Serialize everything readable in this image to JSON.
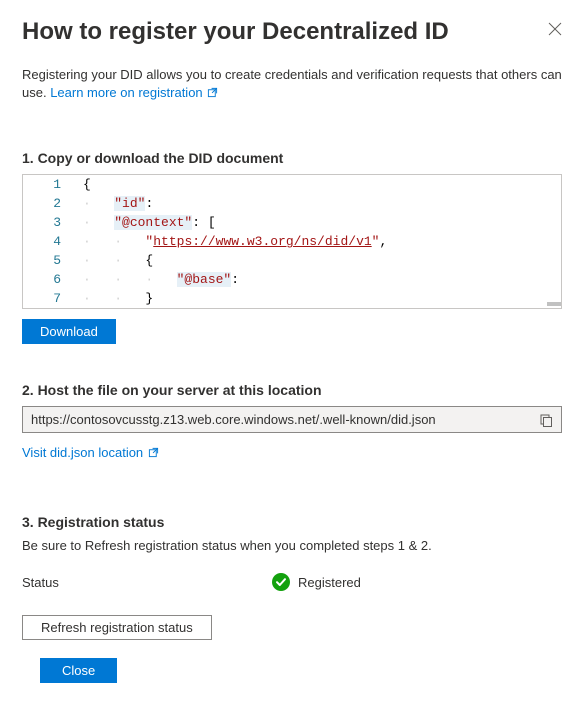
{
  "header": {
    "title": "How to register your Decentralized ID"
  },
  "intro": {
    "text": "Registering your DID allows you to create credentials and verification requests that others can use. ",
    "link_text": "Learn more on registration"
  },
  "step1": {
    "heading": "1. Copy or download the DID document",
    "download_label": "Download",
    "code_lines": [
      {
        "n": "1",
        "indent": 0,
        "tokens": [
          {
            "t": "brace",
            "v": "{"
          }
        ]
      },
      {
        "n": "2",
        "indent": 1,
        "tokens": [
          {
            "t": "key",
            "v": "\"id\""
          },
          {
            "t": "colon",
            "v": ":"
          }
        ]
      },
      {
        "n": "3",
        "indent": 1,
        "tokens": [
          {
            "t": "key",
            "v": "\"@context\""
          },
          {
            "t": "colon",
            "v": ": "
          },
          {
            "t": "brace",
            "v": "["
          }
        ]
      },
      {
        "n": "4",
        "indent": 2,
        "tokens": [
          {
            "t": "quote",
            "v": "\""
          },
          {
            "t": "str",
            "v": "https://www.w3.org/ns/did/v1"
          },
          {
            "t": "quote",
            "v": "\""
          },
          {
            "t": "comma",
            "v": ","
          }
        ]
      },
      {
        "n": "5",
        "indent": 2,
        "tokens": [
          {
            "t": "brace",
            "v": "{"
          }
        ]
      },
      {
        "n": "6",
        "indent": 3,
        "tokens": [
          {
            "t": "key",
            "v": "\"@base\""
          },
          {
            "t": "colon",
            "v": ":"
          }
        ]
      },
      {
        "n": "7",
        "indent": 2,
        "tokens": [
          {
            "t": "brace",
            "v": "}"
          }
        ]
      }
    ]
  },
  "step2": {
    "heading": "2. Host the file on your server at this location",
    "url": "https://contosovcusstg.z13.web.core.windows.net/.well-known/did.json",
    "visit_link": "Visit did.json location"
  },
  "step3": {
    "heading": "3. Registration status",
    "hint": "Be sure to Refresh registration status when you completed steps 1 & 2.",
    "status_label": "Status",
    "status_value": "Registered",
    "refresh_label": "Refresh registration status"
  },
  "footer": {
    "close_label": "Close"
  }
}
